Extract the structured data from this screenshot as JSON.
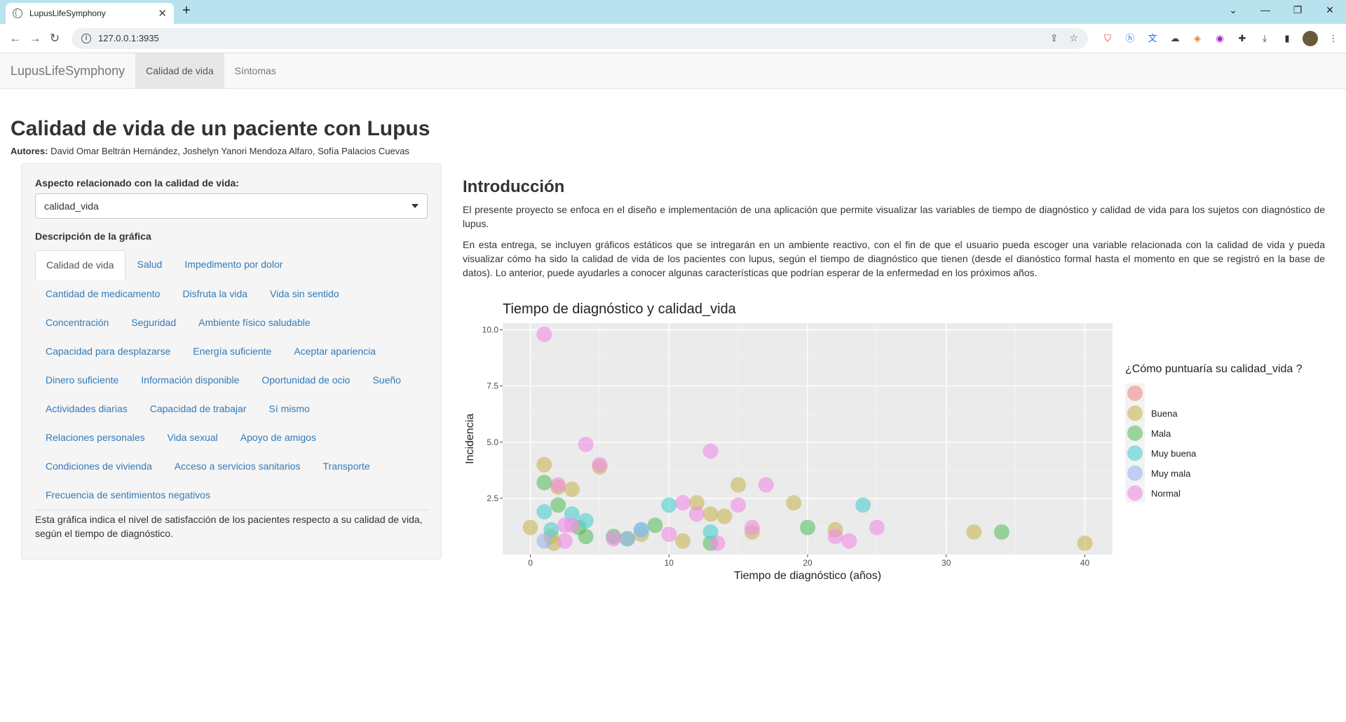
{
  "browser": {
    "tab_title": "LupusLifeSymphony",
    "url": "127.0.0.1:3935"
  },
  "navbar": {
    "brand": "LupusLifeSymphony",
    "links": [
      "Calidad de vida",
      "Síntomas"
    ]
  },
  "header": {
    "title": "Calidad de vida de un paciente con Lupus",
    "authors_label": "Autores:",
    "authors": "David Omar Beltrán Hernández, Joshelyn Yanori Mendoza Alfaro, Sofía Palacios Cuevas"
  },
  "sidebar": {
    "select_label": "Aspecto relacionado con la calidad de vida:",
    "select_value": "calidad_vida",
    "desc_label": "Descripción de la gráfica",
    "tabs": [
      "Calidad de vida",
      "Salud",
      "Impedimento por dolor",
      "Cantidad de medicamento",
      "Disfruta la vida",
      "Vida sin sentido",
      "Concentración",
      "Seguridad",
      "Ambiente físico saludable",
      "Capacidad para desplazarse",
      "Energía suficiente",
      "Aceptar apariencia",
      "Dinero suficiente",
      "Información disponible",
      "Oportunidad de ocio",
      "Sueño",
      "Actividades diarias",
      "Capacidad de trabajar",
      "Sí mismo",
      "Relaciones personales",
      "Vida sexual",
      "Apoyo de amigos",
      "Condiciones de vivienda",
      "Acceso a servicios sanitarios",
      "Transporte",
      "Frecuencia de sentimientos negativos"
    ],
    "tab_text": "Esta gráfica indica el nivel de satisfacción de los pacientes respecto a su calidad de vida, según el tiempo de diagnóstico."
  },
  "main": {
    "heading": "Introducción",
    "p1": "El presente proyecto se enfoca en el diseño e implementación de una aplicación que permite visualizar las variables de tiempo de diagnóstico y calidad de vida para los sujetos con diagnóstico de lupus.",
    "p2": "En esta entrega, se incluyen gráficos estáticos que se intregarán en un ambiente reactivo, con el fin de que el usuario pueda escoger una variable relacionada con la calidad de vida y pueda visualizar cómo ha sido la calidad de vida de los pacientes con lupus, según el tiempo de diagnóstico que tienen (desde el dianóstico formal hasta el momento en que se registró en la base de datos). Lo anterior, puede ayudarles a conocer algunas características que podrían esperar de la enfermedad en los próximos años."
  },
  "chart_data": {
    "type": "scatter",
    "title": "Tiempo de diagnóstico y calidad_vida",
    "xlabel": "Tiempo de diagnóstico (años)",
    "ylabel": "Incidencia",
    "xlim": [
      -2,
      42
    ],
    "ylim": [
      0.0,
      10.3
    ],
    "xticks": [
      0,
      10,
      20,
      30,
      40
    ],
    "yticks": [
      2.5,
      5.0,
      7.5,
      10.0
    ],
    "ytick_labels": [
      "2.5",
      "5.0",
      "7.5",
      "10.0"
    ],
    "grid": true,
    "legend_title": "¿Cómo puntuaría su calidad_vida ?",
    "legend_position": "right",
    "series": [
      {
        "name": "",
        "color": "#f08a8a",
        "points": []
      },
      {
        "name": "Buena",
        "color": "#c9b55a",
        "points": [
          [
            0,
            1.2
          ],
          [
            1,
            4.0
          ],
          [
            1.5,
            0.8
          ],
          [
            2,
            3.0
          ],
          [
            3,
            2.9
          ],
          [
            5,
            3.9
          ],
          [
            8,
            0.9
          ],
          [
            11,
            0.6
          ],
          [
            12,
            2.3
          ],
          [
            13,
            1.8
          ],
          [
            14,
            1.7
          ],
          [
            15,
            3.1
          ],
          [
            16,
            1.0
          ],
          [
            19,
            2.3
          ],
          [
            22,
            1.1
          ],
          [
            32,
            1.0
          ],
          [
            40,
            0.5
          ],
          [
            1.7,
            0.5
          ]
        ]
      },
      {
        "name": "Mala",
        "color": "#5cc061",
        "points": [
          [
            1,
            3.2
          ],
          [
            2,
            2.2
          ],
          [
            4,
            0.8
          ],
          [
            6,
            0.8
          ],
          [
            7,
            0.7
          ],
          [
            9,
            1.3
          ],
          [
            13,
            0.5
          ],
          [
            20,
            1.2
          ],
          [
            34,
            1.0
          ],
          [
            3.5,
            1.2
          ]
        ]
      },
      {
        "name": "Muy buena",
        "color": "#4ccfd0",
        "points": [
          [
            1,
            1.9
          ],
          [
            1.5,
            1.1
          ],
          [
            3,
            1.8
          ],
          [
            4,
            1.5
          ],
          [
            10,
            2.2
          ],
          [
            13,
            1.0
          ],
          [
            24,
            2.2
          ],
          [
            8,
            1.1
          ]
        ]
      },
      {
        "name": "Muy mala",
        "color": "#9cb6f0",
        "points": [
          [
            1,
            0.6
          ],
          [
            7,
            0.7
          ],
          [
            8,
            1.1
          ]
        ]
      },
      {
        "name": "Normal",
        "color": "#f08ce6",
        "points": [
          [
            1,
            9.8
          ],
          [
            2,
            3.1
          ],
          [
            2.5,
            1.3
          ],
          [
            3,
            1.3
          ],
          [
            4,
            4.9
          ],
          [
            5,
            4.0
          ],
          [
            6,
            0.7
          ],
          [
            10,
            0.9
          ],
          [
            11,
            2.3
          ],
          [
            12,
            1.8
          ],
          [
            13,
            4.6
          ],
          [
            13.5,
            0.5
          ],
          [
            15,
            2.2
          ],
          [
            16,
            1.2
          ],
          [
            17,
            3.1
          ],
          [
            22,
            0.8
          ],
          [
            23,
            0.6
          ],
          [
            25,
            1.2
          ],
          [
            2.5,
            0.6
          ]
        ]
      }
    ]
  }
}
